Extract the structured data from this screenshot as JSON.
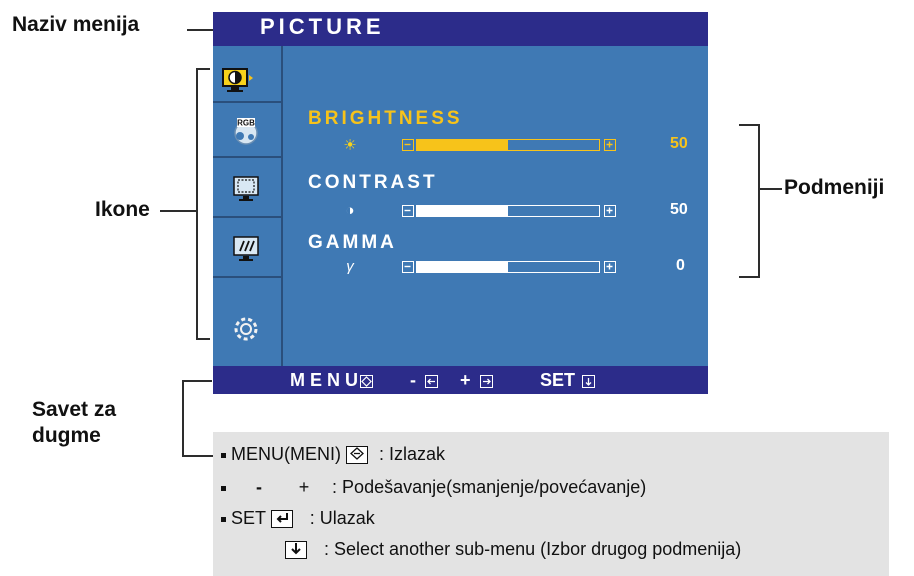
{
  "callouts": {
    "menu_name": "Naziv menija",
    "icons": "Ikone",
    "submenus": "Podmeniji",
    "button_tip_line1": "Savet za",
    "button_tip_line2": "dugme"
  },
  "osd": {
    "title": "PICTURE",
    "sidebar_icons": [
      "picture-icon",
      "rgb-color-icon",
      "screen-position-icon",
      "tracking-icon",
      "settings-gear-icon"
    ],
    "submenus": [
      {
        "label": "BRIGHTNESS",
        "symbol": "☀",
        "value": "50",
        "level": 50,
        "active": true
      },
      {
        "label": "CONTRAST",
        "symbol": "◑",
        "value": "50",
        "level": 50,
        "active": false
      },
      {
        "label": "GAMMA",
        "symbol": "γ",
        "value": "0",
        "level": 50,
        "active": false
      }
    ],
    "footer": {
      "menu": "MENU",
      "minus": "-",
      "plus": "+",
      "set": "SET"
    },
    "colors": {
      "title_bar": "#2c2c8a",
      "body": "#3f79b4",
      "active_label": "#f7c31a"
    }
  },
  "help": {
    "menu_label": "MENU(MENI)",
    "menu_desc": ": Izlazak",
    "minus": "-",
    "plus": "+",
    "adjust_desc": ": Podešavanje(smanjenje/povećavanje)",
    "set_label": "SET",
    "set_desc": ": Ulazak",
    "select_desc": ": Select another sub-menu (Izbor drugog podmenija)"
  }
}
